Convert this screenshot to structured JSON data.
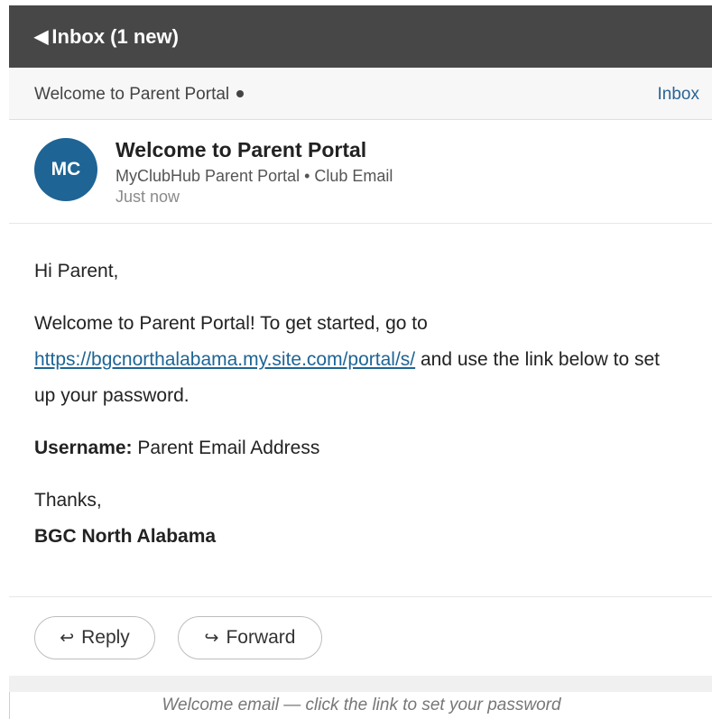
{
  "topbar": {
    "back_icon": "◀",
    "back_label": "Inbox (1 new)"
  },
  "subbar": {
    "subject": "Welcome to Parent Portal",
    "folder": "Inbox"
  },
  "header": {
    "avatar_initials": "MC",
    "title": "Welcome to Parent Portal",
    "sender": "MyClubHub Parent Portal • Club Email",
    "time": "Just now"
  },
  "body": {
    "greeting": "Hi Parent,",
    "welcome_text": "Welcome to Parent Portal! To get started, go to",
    "link": "https://bgcnorthalabama.my.site.com/portal/s/",
    "welcome_text_after": " and use the link below to set up your password.",
    "username_label": "Username:",
    "username_value": " Parent Email Address",
    "thanks": "Thanks,",
    "signature": "BGC North Alabama"
  },
  "actions": {
    "reply_icon": "↩",
    "reply_label": "Reply",
    "forward_icon": "↪",
    "forward_label": "Forward"
  },
  "caption": "Welcome email — click the link to set your password",
  "colors": {
    "topbar": "#474747",
    "accent": "#1e6494",
    "link": "#2a6496"
  }
}
